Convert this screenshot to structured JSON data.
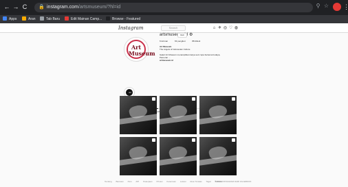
{
  "browser": {
    "url_host": "instagram.com",
    "url_path": "/artsmuseum/?hl=id",
    "bookmarks": [
      {
        "label": "Apps",
        "color": "#4285f4"
      },
      {
        "label": "Aran",
        "color": "#f9ab00"
      },
      {
        "label": "Tab Baru",
        "color": "#9aa0a6"
      },
      {
        "label": "Edit Mainan Camp...",
        "color": "#e53935"
      },
      {
        "label": "Browse - Featured",
        "color": "#202124"
      }
    ],
    "icons": {
      "back": "←",
      "forward": "→",
      "reload": "C",
      "lock": "🔒",
      "search": "⚲",
      "star": "☆",
      "menu": "⋮"
    }
  },
  "instagram": {
    "logo": "Instagram",
    "search_placeholder": "Search",
    "nav_icons": [
      "⌂",
      "✈",
      "◎",
      "♡",
      "◍"
    ],
    "profile": {
      "username": "artsmuseum_id",
      "follow_label": "Ikuti",
      "gear_icon": "⚙",
      "avatar_text": "Art Museum",
      "stats": [
        "6 kiriman",
        "63 pengikut",
        "88 diikuti"
      ],
      "bio": [
        {
          "text": "Art Museum",
          "strong": true
        },
        {
          "text": "The Angels of Indonesian Culture",
          "strong": false
        },
        {
          "text": "",
          "strong": false
        },
        {
          "text": "Galeri Art Museum menampilkan karya seni rupa bertema budaya,",
          "strong": false
        },
        {
          "text": "Pameran ...",
          "strong": false
        },
        {
          "text": "artmuseum.id",
          "strong": true
        }
      ]
    },
    "highlight": {
      "text": "Art",
      "label": "Highlights"
    },
    "tabs": [
      {
        "label": "▦ POSTINGAN",
        "active": true
      },
      {
        "label": "▷ IGTV",
        "active": false
      },
      {
        "label": "⊡ TERSIMPAN",
        "active": false
      },
      {
        "label": "⊡ DITANDAI",
        "active": false
      }
    ],
    "post_count": 6,
    "footer": {
      "links": [
        "Tentang",
        "Bantuan",
        "Pers",
        "API",
        "Pekerjaan",
        "Privasi",
        "Ketentuan",
        "Lokasi",
        "Akun Teratas",
        "Tagar",
        "Bahasa"
      ],
      "copyright": "© 2020 INSTAGRAM DARI FACEBOOK"
    }
  }
}
